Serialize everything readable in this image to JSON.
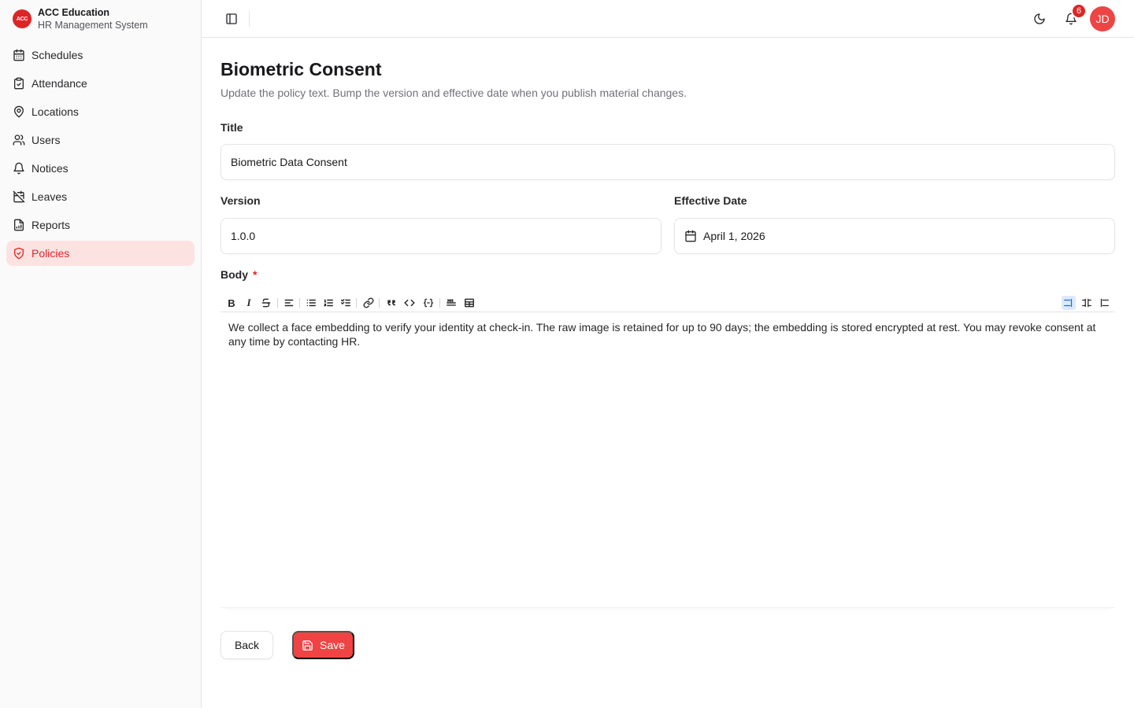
{
  "brand": {
    "logo_text": "ACC",
    "name": "ACC Education",
    "subtitle": "HR Management System"
  },
  "sidebar": {
    "items": [
      {
        "label": "Schedules",
        "icon": "calendar-icon",
        "active": false
      },
      {
        "label": "Attendance",
        "icon": "clipboard-check-icon",
        "active": false
      },
      {
        "label": "Locations",
        "icon": "map-pin-icon",
        "active": false
      },
      {
        "label": "Users",
        "icon": "users-icon",
        "active": false
      },
      {
        "label": "Notices",
        "icon": "bell-icon",
        "active": false
      },
      {
        "label": "Leaves",
        "icon": "calendar-off-icon",
        "active": false
      },
      {
        "label": "Reports",
        "icon": "file-chart-icon",
        "active": false
      },
      {
        "label": "Policies",
        "icon": "shield-check-icon",
        "active": true
      }
    ]
  },
  "header": {
    "notification_count": "6",
    "avatar_initials": "JD"
  },
  "page": {
    "title": "Biometric Consent",
    "subtitle": "Update the policy text. Bump the version and effective date when you publish material changes."
  },
  "form": {
    "title_label": "Title",
    "title_value": "Biometric Data Consent",
    "version_label": "Version",
    "version_value": "1.0.0",
    "date_label": "Effective Date",
    "date_value": "April 1, 2026",
    "body_label": "Body",
    "required_mark": "*",
    "body_text": "We collect a face embedding to verify your identity at check-in. The raw image is retained for up to 90 days; the embedding is stored encrypted at rest. You may revoke consent at any time by contacting HR."
  },
  "toolbar": {
    "bold": "B",
    "italic": "I"
  },
  "actions": {
    "back_label": "Back",
    "save_label": "Save"
  },
  "colors": {
    "accent": "#ef4444",
    "active_bg": "#fde2e2",
    "active_text": "#dc2626"
  }
}
